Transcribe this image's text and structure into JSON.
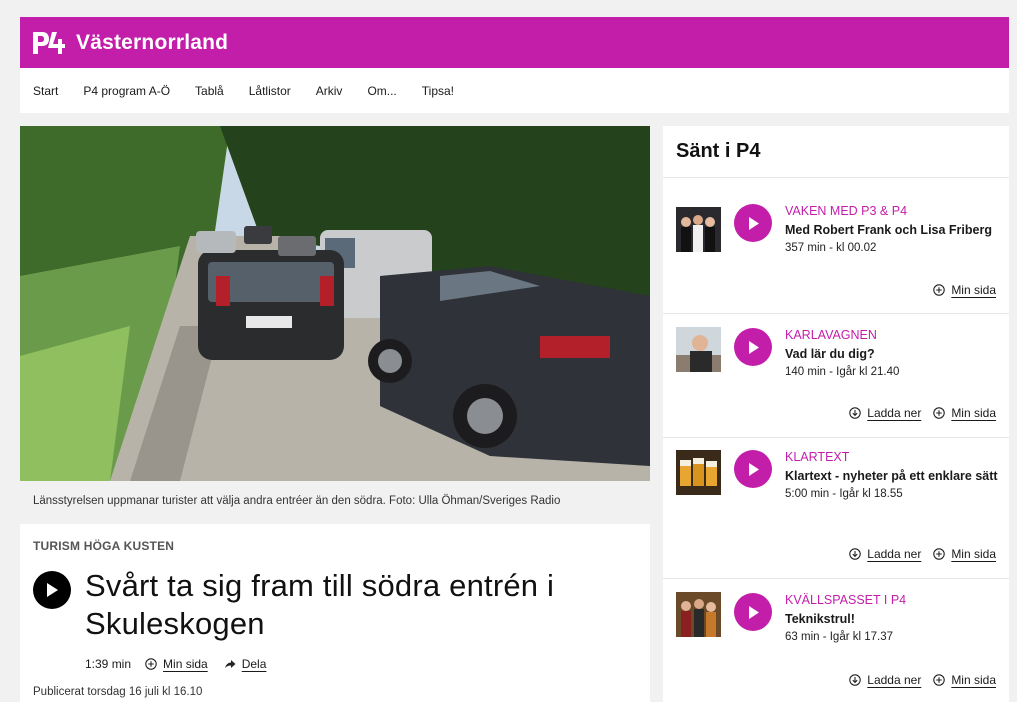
{
  "header": {
    "brand": "Västernorrland",
    "brand_color": "#c31eaa"
  },
  "nav": {
    "items": [
      "Start",
      "P4 program A-Ö",
      "Tablå",
      "Låtlistor",
      "Arkiv",
      "Om...",
      "Tipsa!"
    ]
  },
  "hero": {
    "icon": "road-traffic-photo",
    "caption": "Länsstyrelsen uppmanar turister att välja andra entréer än den södra. Foto: Ulla Öhman/Sveriges Radio"
  },
  "article": {
    "kicker": "TURISM HÖGA KUSTEN",
    "headline": "Svårt ta sig fram till södra entrén i Skuleskogen",
    "duration": "1:39 min",
    "save_label": "Min sida",
    "share_label": "Dela",
    "published": "Publicerat torsdag 16 juli kl 16.10"
  },
  "sidebar": {
    "title": "Sänt i P4",
    "episodes": [
      {
        "show": "VAKEN MED P3 & P4",
        "title": "Med Robert Frank och Lisa Friberg",
        "meta": "357 min  -  kl 00.02",
        "download": "",
        "save": "Min sida"
      },
      {
        "show": "KARLAVAGNEN",
        "title": "Vad lär du dig?",
        "meta": "140 min  -  Igår kl 21.40",
        "download": "Ladda ner",
        "save": "Min sida"
      },
      {
        "show": "KLARTEXT",
        "title": "Klartext - nyheter på ett enklare sätt",
        "meta": "5:00 min  -  Igår kl 18.55",
        "download": "Ladda ner",
        "save": "Min sida"
      },
      {
        "show": "KVÄLLSPASSET I P4",
        "title": "Teknikstrul!",
        "meta": "63 min  -  Igår kl 17.37",
        "download": "Ladda ner",
        "save": "Min sida"
      }
    ]
  }
}
